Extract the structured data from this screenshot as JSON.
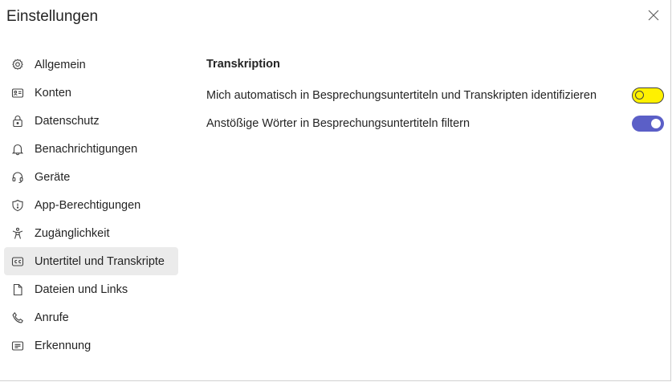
{
  "dialog": {
    "title": "Einstellungen",
    "close_icon": "close-icon"
  },
  "sidebar": {
    "items": [
      {
        "label": "Allgemein",
        "icon": "gear-icon",
        "active": false
      },
      {
        "label": "Konten",
        "icon": "contact-card-icon",
        "active": false
      },
      {
        "label": "Datenschutz",
        "icon": "lock-icon",
        "active": false
      },
      {
        "label": "Benachrichtigungen",
        "icon": "bell-icon",
        "active": false
      },
      {
        "label": "Geräte",
        "icon": "headset-icon",
        "active": false
      },
      {
        "label": "App-Berechtigungen",
        "icon": "shield-icon",
        "active": false
      },
      {
        "label": "Zugänglichkeit",
        "icon": "accessibility-icon",
        "active": false
      },
      {
        "label": "Untertitel und Transkripte",
        "icon": "closed-captions-icon",
        "active": true
      },
      {
        "label": "Dateien und Links",
        "icon": "document-icon",
        "active": false
      },
      {
        "label": "Anrufe",
        "icon": "phone-icon",
        "active": false
      },
      {
        "label": "Erkennung",
        "icon": "text-box-icon",
        "active": false
      }
    ]
  },
  "main": {
    "section_title": "Transkription",
    "settings": [
      {
        "label": "Mich automatisch in Besprechungsuntertiteln und Transkripten identifizieren",
        "enabled": false
      },
      {
        "label": "Anstößige Wörter in Besprechungsuntertiteln filtern",
        "enabled": true
      }
    ]
  },
  "colors": {
    "accent": "#5b5fc7",
    "highlight_toggle": "#fff100",
    "active_nav_bg": "#ebebeb",
    "text": "#242424"
  }
}
